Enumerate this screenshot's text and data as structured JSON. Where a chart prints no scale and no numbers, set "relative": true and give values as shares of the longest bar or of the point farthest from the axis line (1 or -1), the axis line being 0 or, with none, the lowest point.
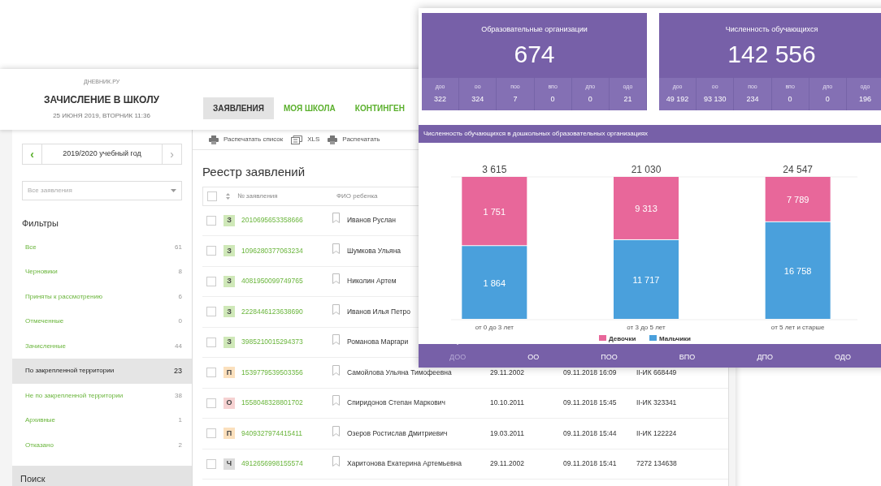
{
  "app": {
    "brand": "ДНЕВНИК.РУ",
    "title": "ЗАЧИСЛЕНИЕ В ШКОЛУ",
    "datetime": "25 ИЮНЯ 2019, ВТОРНИК 11:36"
  },
  "nav_tabs": [
    {
      "label": "ЗАЯВЛЕНИЯ",
      "selected": true
    },
    {
      "label": "МОЯ ШКОЛА",
      "selected": false
    },
    {
      "label": "КОНТИНГЕН",
      "selected": false
    }
  ],
  "sidebar": {
    "year_prev": "‹",
    "year": "2019/2020 учебный год",
    "year_next": "›",
    "select_placeholder": "Все заявления",
    "filters_title": "Фильтры",
    "filters": [
      {
        "label": "Все",
        "count": "61",
        "selected": false
      },
      {
        "label": "Черновики",
        "count": "8",
        "selected": false
      },
      {
        "label": "Приняты к рассмотрению",
        "count": "6",
        "selected": false
      },
      {
        "label": "Отмеченные",
        "count": "0",
        "selected": false
      },
      {
        "label": "Зачисленные",
        "count": "44",
        "selected": false
      },
      {
        "label": "По закрепленной территории",
        "count": "23",
        "selected": true
      },
      {
        "label": "Не по закрепленной территории",
        "count": "38",
        "selected": false
      },
      {
        "label": "Архивные",
        "count": "1",
        "selected": false
      },
      {
        "label": "Отказано",
        "count": "2",
        "selected": false
      }
    ],
    "search_title": "Поиск"
  },
  "toolbar": [
    {
      "kind": "print",
      "label": "Распечатать список"
    },
    {
      "kind": "xls",
      "label": "XLS"
    },
    {
      "kind": "print",
      "label": "Распечатать"
    }
  ],
  "registry": {
    "title": "Реестр заявлений",
    "select_all_checked": false,
    "columns": [
      "№ заявления",
      "ФИО ребенка"
    ],
    "rows": [
      {
        "status": "З",
        "color": "#cfe8b8",
        "checked": false,
        "number": "2010695653358666",
        "name": "Иванов Руслан"
      },
      {
        "status": "З",
        "color": "#cfe8b8",
        "checked": false,
        "number": "1096280377063234",
        "name": "Шумкова Ульяна"
      },
      {
        "status": "З",
        "color": "#cfe8b8",
        "checked": false,
        "number": "4081950099749765",
        "name": "Николин Артем"
      },
      {
        "status": "З",
        "color": "#cfe8b8",
        "checked": false,
        "number": "2228446123638690",
        "name": "Иванов Илья Петро"
      },
      {
        "status": "З",
        "color": "#cfe8b8",
        "checked": false,
        "number": "3985210015294373",
        "name": "Романова Маргари"
      },
      {
        "status": "П",
        "color": "#fbe0bd",
        "checked": false,
        "number": "1539779539503356",
        "name": "Самойлова Ульяна Тимофеевна",
        "birth": "29.11.2002",
        "submitted": "09.11.2018 16:09",
        "document": "II-ИК 668449"
      },
      {
        "status": "О",
        "color": "#f6d2d2",
        "checked": false,
        "number": "1558048328801702",
        "name": "Спиридонов Степан Маркович",
        "birth": "10.10.2011",
        "submitted": "09.11.2018 15:45",
        "document": "II-ИК 323341"
      },
      {
        "status": "П",
        "color": "#fbe0bd",
        "checked": false,
        "number": "9409327974415411",
        "name": "Озеров Ростислав Дмитриевич",
        "birth": "19.03.2011",
        "submitted": "09.11.2018 15:44",
        "document": "II-ИК 122224"
      },
      {
        "status": "Ч",
        "color": "#dcdcdc",
        "checked": false,
        "number": "4912656998155574",
        "name": "Харитонова Екатерина Артемьевна",
        "birth": "29.11.2002",
        "submitted": "09.11.2018 15:41",
        "document": "7272 134638"
      }
    ]
  },
  "stat_cards": [
    {
      "title": "Образовательные организации",
      "value": "674",
      "cells": [
        {
          "label": "доо",
          "value": "322"
        },
        {
          "label": "оо",
          "value": "324"
        },
        {
          "label": "поо",
          "value": "7"
        },
        {
          "label": "впо",
          "value": "0"
        },
        {
          "label": "дпо",
          "value": "0"
        },
        {
          "label": "одо",
          "value": "21"
        }
      ]
    },
    {
      "title": "Численность обучающихся",
      "value": "142 556",
      "cells": [
        {
          "label": "доо",
          "value": "49 192"
        },
        {
          "label": "оо",
          "value": "93 130"
        },
        {
          "label": "поо",
          "value": "234"
        },
        {
          "label": "впо",
          "value": "0"
        },
        {
          "label": "дпо",
          "value": "0"
        },
        {
          "label": "одо",
          "value": "196"
        }
      ]
    }
  ],
  "chart_panel": {
    "title": "Численность обучающихся в дошкольных образовательных организациях",
    "chart_data": {
      "type": "bar",
      "stacked": true,
      "relative": true,
      "legend": "bottom",
      "categories": [
        "от 0 до 3 лет",
        "от 3 до 5 лет",
        "от 5 лет и старше"
      ],
      "series": [
        {
          "name": "Девочки",
          "color": "#e8679a",
          "values": [
            0.4844,
            0.4428,
            0.3173
          ]
        },
        {
          "name": "Мальчики",
          "color": "#4aa0dc",
          "values": [
            0.5156,
            0.5572,
            0.6827
          ]
        }
      ],
      "value_labels": [
        [
          "1 751",
          "9 313",
          "7 789"
        ],
        [
          "1 864",
          "11 717",
          "16 758"
        ]
      ],
      "annotations": [
        "3 615",
        "21 030",
        "24 547"
      ]
    },
    "tabs": [
      {
        "label": "ДОО",
        "selected": true
      },
      {
        "label": "ОО",
        "selected": false
      },
      {
        "label": "ПОО",
        "selected": false
      },
      {
        "label": "ВПО",
        "selected": false
      },
      {
        "label": "ДПО",
        "selected": false
      },
      {
        "label": "ОДО",
        "selected": false
      }
    ]
  }
}
